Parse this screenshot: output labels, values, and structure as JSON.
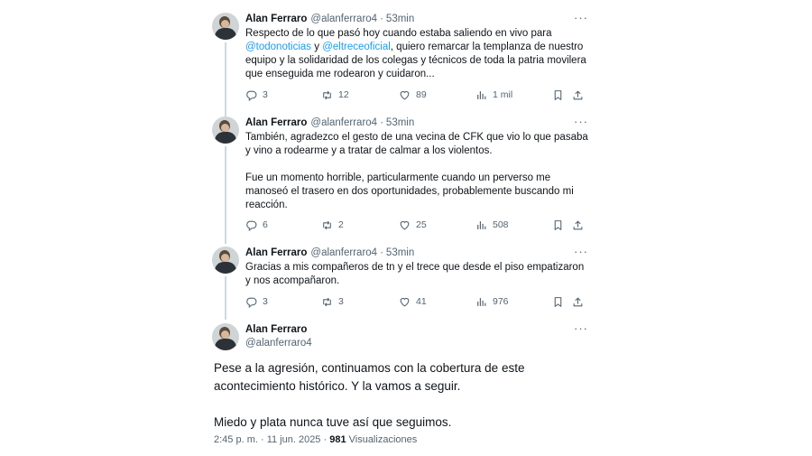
{
  "tweets": [
    {
      "name": "Alan Ferraro",
      "handle": "@alanferraro4",
      "separator": "·",
      "time": "53min",
      "more": "···",
      "text_parts": {
        "a": "Respecto de lo que pasó hoy cuando estaba saliendo en vivo para ",
        "m1": "@todonoticias",
        "b": " y ",
        "m2": "@eltreceoficial",
        "c": ", quiero remarcar la templanza de nuestro equipo y la solidaridad de los colegas y técnicos de toda la patria movilera que enseguida me rodearon y cuidaron..."
      },
      "stats": {
        "replies": "3",
        "reposts": "12",
        "likes": "89",
        "views": "1 mil"
      }
    },
    {
      "name": "Alan Ferraro",
      "handle": "@alanferraro4",
      "separator": "·",
      "time": "53min",
      "more": "···",
      "text": "También, agradezco el gesto de una vecina de CFK que vio lo que pasaba y vino a rodearme y a tratar de calmar a los violentos.\n\nFue un momento horrible, particularmente cuando un perverso me manoseó el trasero en dos oportunidades, probablemente buscando mi reacción.",
      "stats": {
        "replies": "6",
        "reposts": "2",
        "likes": "25",
        "views": "508"
      }
    },
    {
      "name": "Alan Ferraro",
      "handle": "@alanferraro4",
      "separator": "·",
      "time": "53min",
      "more": "···",
      "text": "Gracias a mis compañeros de tn y el trece que desde el piso empatizaron y nos acompañaron.",
      "stats": {
        "replies": "3",
        "reposts": "3",
        "likes": "41",
        "views": "976"
      }
    }
  ],
  "main": {
    "name": "Alan Ferraro",
    "handle": "@alanferraro4",
    "more": "···",
    "text": "Pese a la agresión, continuamos con la cobertura de este acontecimiento histórico. Y la vamos a seguir.\n\nMiedo y plata nunca tuve así que seguimos.",
    "meta_time": "2:45 p. m. · 11 jun. 2025 · ",
    "meta_views_count": "981",
    "meta_views_label": " Visualizaciones"
  },
  "icons": [
    "reply-icon",
    "repost-icon",
    "like-icon",
    "views-icon",
    "bookmark-icon",
    "share-icon",
    "more-icon"
  ],
  "colors": {
    "link": "#1d9bf0",
    "secondary": "#536471",
    "text": "#0f1419",
    "line": "#cfd9de"
  }
}
